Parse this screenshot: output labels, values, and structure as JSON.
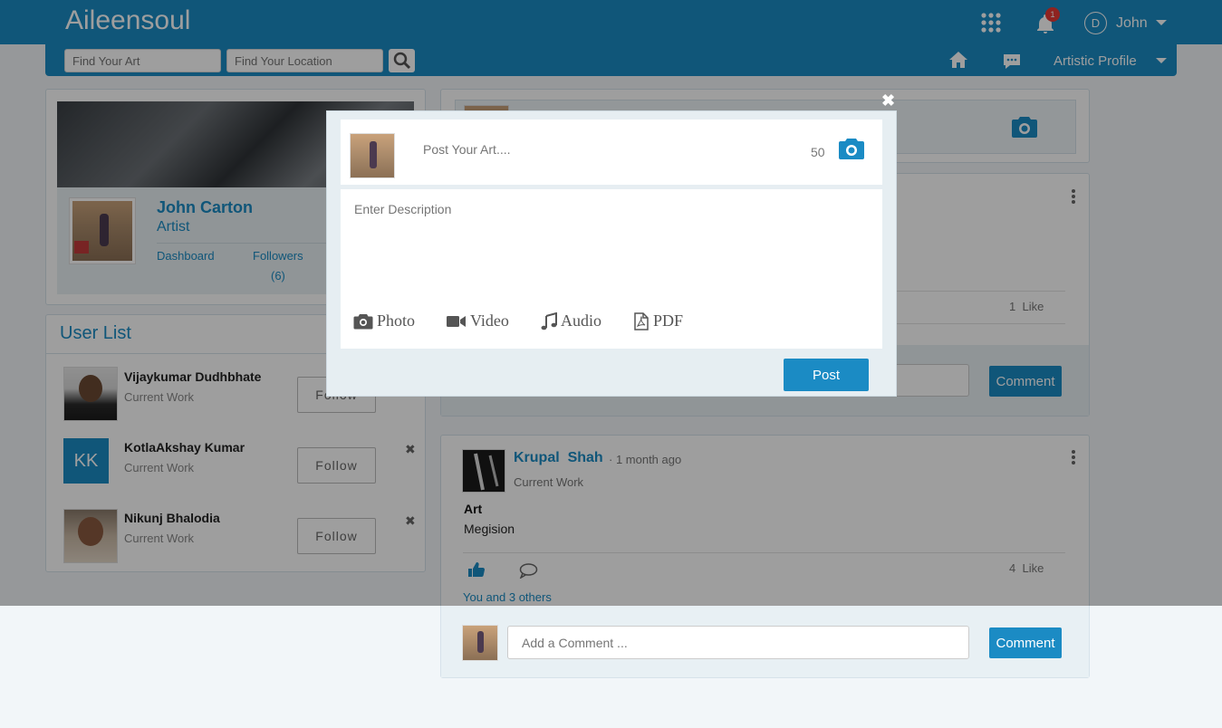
{
  "header": {
    "brand": "Aileensoul",
    "search_art_placeholder": "Find Your Art",
    "search_location_placeholder": "Find Your Location",
    "notification_count": "1",
    "user_initial": "D",
    "user_name": "John",
    "artistic_profile_label": "Artistic Profile"
  },
  "profile_card": {
    "name": "John Carton",
    "role": "Artist",
    "dashboard_label": "Dashboard",
    "followers_label": "Followers",
    "followers_count": "(6)"
  },
  "user_list": {
    "title": "User List",
    "users": [
      {
        "name": "Vijaykumar Dudhbhate",
        "work": "Current Work",
        "follow_label": "Follow"
      },
      {
        "name": "KotlaAkshay Kumar",
        "work": "Current Work",
        "follow_label": "Follow",
        "initials": "KK"
      },
      {
        "name": "Nikunj Bhalodia",
        "work": "Current Work",
        "follow_label": "Follow"
      }
    ]
  },
  "feed": {
    "post1": {
      "like_count": "1",
      "like_label": "Like",
      "comment_button": "Comment"
    },
    "post2": {
      "author_first": "Krupal",
      "author_last": "Shah",
      "time": "· 1 month ago",
      "work": "Current Work",
      "title": "Art",
      "description": "Megision",
      "like_count": "4",
      "like_label": "Like",
      "likers": "You and 3 others",
      "comment_placeholder": "Add a Comment ...",
      "comment_button": "Comment"
    }
  },
  "modal": {
    "title_placeholder": "Post Your Art....",
    "char_count": "50",
    "description_placeholder": "Enter Description",
    "photo_label": "Photo",
    "video_label": "Video",
    "audio_label": "Audio",
    "pdf_label": "PDF",
    "post_button": "Post"
  },
  "colors": {
    "primary": "#1b8bc4",
    "badge": "#e53935",
    "kk_avatar": "#1b8bc4"
  }
}
